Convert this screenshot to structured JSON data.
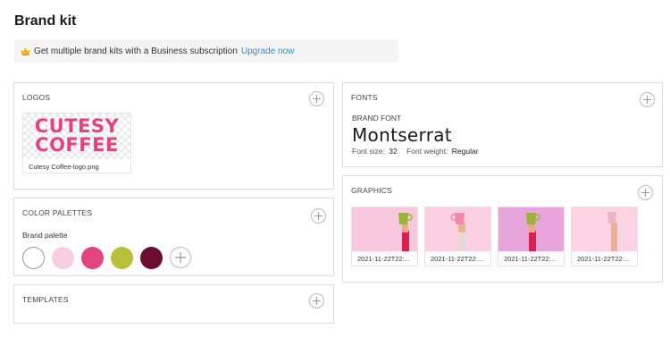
{
  "page": {
    "title": "Brand kit"
  },
  "upsell": {
    "message": "Get multiple brand kits with a Business subscription",
    "link_label": "Upgrade now",
    "icon": "crown-icon"
  },
  "logos": {
    "title": "LOGOS",
    "items": [
      {
        "line1": "CUTESY",
        "line2": "COFFEE",
        "filename": "Cutesy Coffee-logo.png",
        "color": "#e3447b"
      }
    ]
  },
  "palettes": {
    "title": "COLOR PALETTES",
    "palette_name": "Brand palette",
    "colors": [
      "#ffffff",
      "#f8cde2",
      "#e3447b",
      "#b6c03b",
      "#6a0d2e"
    ]
  },
  "templates": {
    "title": "TEMPLATES"
  },
  "fonts": {
    "title": "FONTS",
    "brand_font_label": "BRAND FONT",
    "font_name": "Montserrat",
    "size_label": "Font size:",
    "size_value": "32",
    "weight_label": "Font weight:",
    "weight_value": "Regular"
  },
  "graphics": {
    "title": "GRAPHICS",
    "items": [
      {
        "name": "2021-11-22T22:...",
        "bg": "#f6c7dd",
        "cup": "#9bb33a"
      },
      {
        "name": "2021-11-22T22:...",
        "bg": "#f9cfe1",
        "cup": "#f08aa6"
      },
      {
        "name": "2021-11-22T22:...",
        "bg": "#e7a5dc",
        "cup": "#9bb33a"
      },
      {
        "name": "2021-11-22T22:...",
        "bg": "#fbd3e3",
        "cup": "#e9b4c4"
      }
    ]
  }
}
